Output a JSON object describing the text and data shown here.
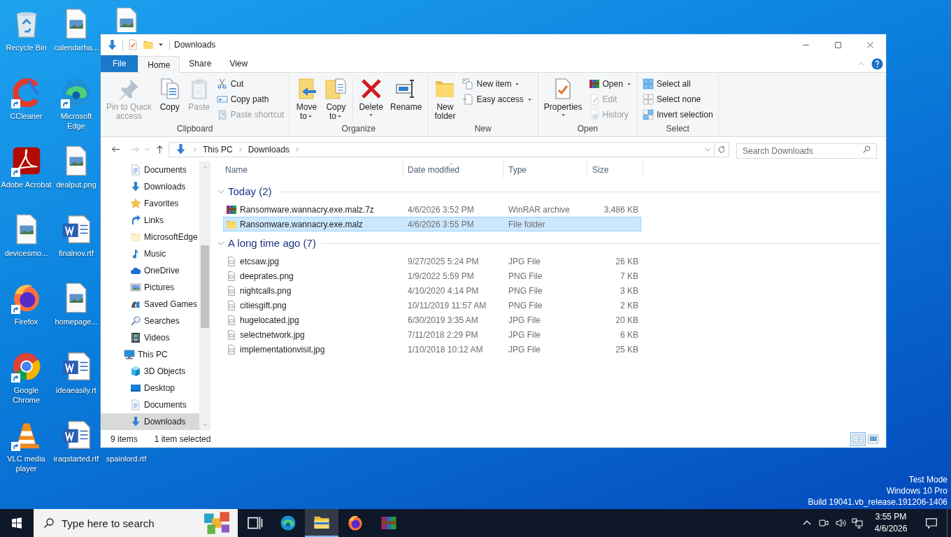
{
  "desktop": {
    "columns": [
      [
        {
          "label": "Recycle Bin",
          "kind": "recycle",
          "shortcut": false
        },
        {
          "label": "CCleaner",
          "kind": "ccleaner",
          "shortcut": true
        },
        {
          "label": "Adobe Acrobat",
          "kind": "acrobat",
          "shortcut": true
        },
        {
          "label": "devicesmo...",
          "kind": "image",
          "shortcut": false
        },
        {
          "label": "Firefox",
          "kind": "firefox",
          "shortcut": true
        },
        {
          "label": "Google Chrome",
          "kind": "chrome",
          "shortcut": true
        },
        {
          "label": "VLC media player",
          "kind": "vlc",
          "shortcut": true
        }
      ],
      [
        {
          "label": "calendarha...",
          "kind": "image",
          "shortcut": false
        },
        {
          "label": "Microsoft Edge",
          "kind": "edge",
          "shortcut": true
        },
        {
          "label": "dealput.png",
          "kind": "image",
          "shortcut": false
        },
        {
          "label": "finalnov.rtf",
          "kind": "word",
          "shortcut": false
        },
        {
          "label": "homepage...",
          "kind": "image",
          "shortcut": false
        },
        {
          "label": "ideaeasily.rt",
          "kind": "word",
          "shortcut": false
        },
        {
          "label": "iraqstarted.rtf",
          "kind": "word",
          "shortcut": false
        }
      ],
      [
        {
          "kind": "image",
          "shortcut": false
        },
        {
          "label": "spainlord.rtf",
          "shortcut": false
        }
      ]
    ],
    "system_info": [
      "Test Mode",
      "Windows 10 Pro",
      "Build 19041.vb_release.191206-1406"
    ]
  },
  "window": {
    "title": "Downloads"
  },
  "ribbon": {
    "tabs": [
      {
        "label": "File",
        "kind": "file",
        "selected": false
      },
      {
        "label": "Home",
        "kind": "tab",
        "selected": true
      },
      {
        "label": "Share",
        "kind": "tab",
        "selected": false
      },
      {
        "label": "View",
        "kind": "tab",
        "selected": false
      }
    ],
    "groups": [
      {
        "label": "Clipboard",
        "items": [
          {
            "kind": "pin",
            "label": "Pin to Quick\naccess",
            "disabled": true,
            "dropdown": false
          },
          {
            "kind": "copy",
            "label": "Copy",
            "disabled": false,
            "dropdown": false
          },
          {
            "kind": "paste",
            "label": "Paste",
            "disabled": true,
            "dropdown": false
          },
          {
            "kind": "stack",
            "items": [
              {
                "kind": "cut",
                "label": "Cut",
                "disabled": false,
                "dropdown": false
              },
              {
                "kind": "copypath",
                "label": "Copy path",
                "disabled": false,
                "dropdown": false
              },
              {
                "kind": "pasteshortcut",
                "label": "Paste shortcut",
                "disabled": true,
                "dropdown": false
              }
            ]
          }
        ]
      },
      {
        "label": "Organize",
        "items": [
          {
            "kind": "moveto",
            "label": "Move\nto",
            "disabled": false,
            "dropdown": true
          },
          {
            "kind": "copyto",
            "label": "Copy\nto",
            "disabled": false,
            "dropdown": true
          },
          {
            "kind": "separator"
          },
          {
            "kind": "delete",
            "label": "Delete",
            "disabled": false,
            "dropdown": true
          },
          {
            "kind": "rename",
            "label": "Rename",
            "disabled": false,
            "dropdown": false
          }
        ]
      },
      {
        "label": "New",
        "items": [
          {
            "kind": "folder",
            "label": "New\nfolder",
            "disabled": false,
            "dropdown": false
          },
          {
            "kind": "stack",
            "items": [
              {
                "kind": "newitem",
                "label": "New item",
                "disabled": false,
                "dropdown": true
              },
              {
                "kind": "easyaccess",
                "label": "Easy access",
                "disabled": false,
                "dropdown": true
              }
            ]
          }
        ]
      },
      {
        "label": "Open",
        "items": [
          {
            "kind": "props",
            "label": "Properties",
            "disabled": false,
            "dropdown": true
          },
          {
            "kind": "stack",
            "items": [
              {
                "kind": "winrar",
                "label": "Open",
                "disabled": false,
                "dropdown": true
              },
              {
                "kind": "edit",
                "label": "Edit",
                "disabled": true,
                "dropdown": false
              },
              {
                "kind": "history",
                "label": "History",
                "disabled": true,
                "dropdown": false
              }
            ]
          }
        ]
      },
      {
        "label": "Select",
        "items": [
          {
            "kind": "stack",
            "items": [
              {
                "kind": "selectall",
                "label": "Select all",
                "disabled": false,
                "dropdown": false
              },
              {
                "kind": "selectnone",
                "label": "Select none",
                "disabled": false,
                "dropdown": false
              },
              {
                "kind": "invert",
                "label": "Invert selection",
                "disabled": false,
                "dropdown": false
              }
            ]
          }
        ]
      }
    ]
  },
  "address_bar": {
    "breadcrumbs": [
      "This PC",
      "Downloads"
    ],
    "search": {
      "placeholder": "Search Downloads"
    }
  },
  "nav_pane": {
    "items": [
      {
        "children": [
          {
            "label": "Documents",
            "kind": "doc",
            "selected": false
          },
          {
            "label": "Downloads",
            "kind": "arrowdown",
            "selected": false
          },
          {
            "label": "Favorites",
            "kind": "star",
            "selected": false
          },
          {
            "label": "Links",
            "kind": "links",
            "selected": false
          },
          {
            "label": "MicrosoftEdge",
            "kind": "folderpale",
            "selected": false
          },
          {
            "label": "Music",
            "kind": "music",
            "selected": false
          },
          {
            "label": "OneDrive",
            "kind": "cloud",
            "selected": false
          },
          {
            "label": "Pictures",
            "kind": "pictures",
            "selected": false
          },
          {
            "label": "Saved Games",
            "kind": "games",
            "selected": false
          },
          {
            "label": "Searches",
            "kind": "searches",
            "selected": false
          },
          {
            "label": "Videos",
            "kind": "film",
            "selected": false
          }
        ]
      },
      {
        "label": "This PC",
        "kind": "pc",
        "selected": false,
        "children": [
          {
            "label": "3D Objects",
            "kind": "cube",
            "selected": false
          },
          {
            "label": "Desktop",
            "kind": "desktopfolder",
            "selected": false
          },
          {
            "label": "Documents",
            "kind": "doc",
            "selected": false
          },
          {
            "label": "Downloads",
            "kind": "arrowdown",
            "selected": true
          }
        ]
      }
    ]
  },
  "file_list": {
    "columns": [
      {
        "label": "Name",
        "sorted": false
      },
      {
        "label": "Date modified",
        "sorted": true
      },
      {
        "label": "Type",
        "sorted": false
      },
      {
        "label": "Size",
        "sorted": false
      }
    ],
    "groups": [
      {
        "title": "Today (2)",
        "expanded": true,
        "rows": [
          {
            "name": "Ransomware.wannacry.exe.malz.7z",
            "kind": "winrar",
            "date": "4/6/2026 3:52 PM",
            "type": "WinRAR archive",
            "size": "3,486 KB",
            "selected": false
          },
          {
            "name": "Ransomware.wannacry.exe.malz",
            "kind": "folder",
            "date": "4/6/2026 3:55 PM",
            "type": "File folder",
            "selected": true
          }
        ]
      },
      {
        "title": "A long time ago (7)",
        "expanded": true,
        "rows": [
          {
            "name": "etcsaw.jpg",
            "kind": "file",
            "date": "9/27/2025 5:24 PM",
            "type": "JPG File",
            "size": "26 KB",
            "selected": false
          },
          {
            "name": "deeprates.png",
            "kind": "file",
            "date": "1/9/2022 5:59 PM",
            "type": "PNG File",
            "size": "7 KB",
            "selected": false
          },
          {
            "name": "nightcalls.png",
            "kind": "file",
            "date": "4/10/2020 4:14 PM",
            "type": "PNG File",
            "size": "3 KB",
            "selected": false
          },
          {
            "name": "citiesgift.png",
            "kind": "file",
            "date": "10/11/2019 11:57 AM",
            "type": "PNG File",
            "size": "2 KB",
            "selected": false
          },
          {
            "name": "hugelocated.jpg",
            "kind": "file",
            "date": "6/30/2019 3:35 AM",
            "type": "JPG File",
            "size": "20 KB",
            "selected": false
          },
          {
            "name": "selectnetwork.jpg",
            "kind": "file",
            "date": "7/11/2018 2:29 PM",
            "type": "JPG File",
            "size": "6 KB",
            "selected": false
          },
          {
            "name": "implementationvisit.jpg",
            "kind": "file",
            "date": "1/10/2018 10:12 AM",
            "type": "JPG File",
            "size": "25 KB",
            "selected": false
          }
        ]
      }
    ]
  },
  "status_bar": {
    "item_count": "9 items",
    "selection": "1 item selected",
    "views": [
      {
        "kind": "details",
        "selected": true
      },
      {
        "kind": "tiles",
        "selected": false
      }
    ]
  },
  "taskbar": {
    "search": {
      "placeholder": "Type here to search"
    },
    "apps": [
      {
        "kind": "taskview",
        "active": false
      },
      {
        "kind": "edge",
        "active": false
      },
      {
        "kind": "explorer",
        "active": true
      },
      {
        "kind": "firefox",
        "active": false
      },
      {
        "kind": "winrar",
        "active": false
      }
    ],
    "tray": {
      "icons": [
        {
          "kind": "chevronup"
        },
        {
          "kind": "meet"
        },
        {
          "kind": "volume"
        },
        {
          "kind": "network"
        }
      ],
      "time": "3:55 PM",
      "date": "4/6/2026"
    }
  }
}
